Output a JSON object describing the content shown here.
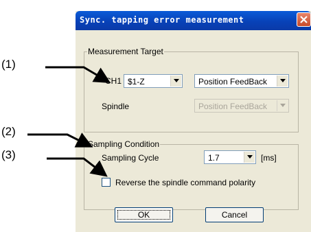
{
  "callouts": [
    "(1)",
    "(2)",
    "(3)"
  ],
  "dialog": {
    "title": "Sync. tapping error measurement",
    "measurement_target": {
      "group_label": "Measurement Target",
      "ch1_label": "CH1",
      "ch1_axis_value": "$1-Z",
      "ch1_signal_value": "Position FeedBack",
      "spindle_label": "Spindle",
      "spindle_signal_value": "Position FeedBack"
    },
    "sampling_condition": {
      "group_label": "Sampling Condition",
      "cycle_label": "Sampling Cycle",
      "cycle_value": "1.7",
      "cycle_unit": "[ms]",
      "reverse_label": "Reverse the spindle command polarity",
      "reverse_checked": false
    },
    "ok_label": "OK",
    "cancel_label": "Cancel"
  },
  "colors": {
    "title_bar": "#0842b8",
    "close_button": "#c94a2a",
    "dialog_bg": "#ece9d8"
  }
}
